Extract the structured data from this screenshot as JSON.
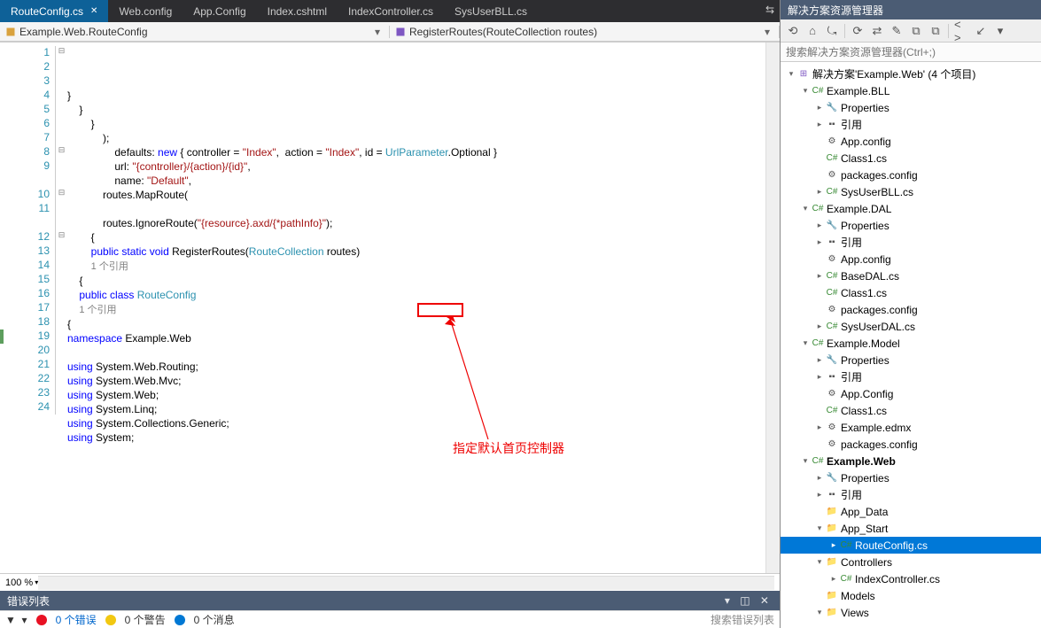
{
  "tabs": [
    {
      "label": "RouteConfig.cs",
      "active": true
    },
    {
      "label": "Web.config"
    },
    {
      "label": "App.Config"
    },
    {
      "label": "Index.cshtml"
    },
    {
      "label": "IndexController.cs"
    },
    {
      "label": "SysUserBLL.cs"
    }
  ],
  "breadcrumb": {
    "left": "Example.Web.RouteConfig",
    "right": "RegisterRoutes(RouteCollection routes)"
  },
  "code": {
    "lines": [
      {
        "n": "1",
        "h": "<span class='kw'>using</span> System;"
      },
      {
        "n": "2",
        "h": "<span class='kw'>using</span> System.Collections.Generic;"
      },
      {
        "n": "3",
        "h": "<span class='kw'>using</span> System.Linq;"
      },
      {
        "n": "4",
        "h": "<span class='kw'>using</span> System.Web;"
      },
      {
        "n": "5",
        "h": "<span class='kw'>using</span> System.Web.Mvc;"
      },
      {
        "n": "6",
        "h": "<span class='kw'>using</span> System.Web.Routing;"
      },
      {
        "n": "7",
        "h": ""
      },
      {
        "n": "8",
        "h": "<span class='kw'>namespace</span> Example.Web"
      },
      {
        "n": "9",
        "h": "{"
      },
      {
        "n": "",
        "h": "    <span class='cm'>1 个引用</span>"
      },
      {
        "n": "10",
        "h": "    <span class='kw'>public</span> <span class='kw'>class</span> <span class='tp'>RouteConfig</span>"
      },
      {
        "n": "11",
        "h": "    {"
      },
      {
        "n": "",
        "h": "        <span class='cm'>1 个引用</span>"
      },
      {
        "n": "12",
        "h": "        <span class='kw'>public</span> <span class='kw'>static</span> <span class='kw'>void</span> RegisterRoutes(<span class='tp'>RouteCollection</span> routes)"
      },
      {
        "n": "13",
        "h": "        {"
      },
      {
        "n": "14",
        "h": "            routes.IgnoreRoute(<span class='st'>\"{resource}.axd/{*pathInfo}\"</span>);"
      },
      {
        "n": "15",
        "h": ""
      },
      {
        "n": "16",
        "h": "            routes.MapRoute("
      },
      {
        "n": "17",
        "h": "                name: <span class='st'>\"Default\"</span>,"
      },
      {
        "n": "18",
        "h": "                url: <span class='st'>\"{controller}/{action}/{id}\"</span>,"
      },
      {
        "n": "19",
        "mod": true,
        "h": "                defaults: <span class='kw'>new</span> { controller = <span class='st'>\"Index\"</span>,  action = <span class='st'>\"Index\"</span>, id = <span class='tp'>UrlParameter</span>.Optional }"
      },
      {
        "n": "20",
        "h": "            );"
      },
      {
        "n": "21",
        "h": "        }"
      },
      {
        "n": "22",
        "h": "    }"
      },
      {
        "n": "23",
        "h": "}"
      },
      {
        "n": "24",
        "h": ""
      }
    ],
    "annotation": "指定默认首页控制器"
  },
  "zoom": "100 %",
  "error_list": {
    "title": "错误列表",
    "filter": "▼   ▾",
    "counts": {
      "errors": "0 个错误",
      "warnings": "0 个警告",
      "messages": "0 个消息"
    },
    "search_placeholder": "搜索错误列表"
  },
  "solution_explorer": {
    "title": "解决方案资源管理器",
    "search_placeholder": "搜索解决方案资源管理器(Ctrl+;)",
    "toolbar": [
      "⟲",
      "⌂",
      "⤿",
      "|",
      "⟳",
      "⇄",
      "✎",
      "⧉",
      "⧉",
      "|",
      "< >",
      "↙",
      "▾"
    ],
    "root": "解决方案'Example.Web' (4 个项目)",
    "tree": [
      {
        "d": 0,
        "exp": "▾",
        "ic": "sln",
        "t": "解决方案'Example.Web' (4 个项目)"
      },
      {
        "d": 1,
        "exp": "▾",
        "ic": "proj",
        "t": "Example.BLL"
      },
      {
        "d": 2,
        "exp": "▸",
        "ic": "wrench",
        "t": "Properties"
      },
      {
        "d": 2,
        "exp": "▸",
        "ic": "ref",
        "t": "引用"
      },
      {
        "d": 2,
        "exp": "",
        "ic": "cfg",
        "t": "App.config"
      },
      {
        "d": 2,
        "exp": "",
        "ic": "cs",
        "t": "Class1.cs"
      },
      {
        "d": 2,
        "exp": "",
        "ic": "cfg",
        "t": "packages.config"
      },
      {
        "d": 2,
        "exp": "▸",
        "ic": "cs",
        "t": "SysUserBLL.cs"
      },
      {
        "d": 1,
        "exp": "▾",
        "ic": "proj",
        "t": "Example.DAL"
      },
      {
        "d": 2,
        "exp": "▸",
        "ic": "wrench",
        "t": "Properties"
      },
      {
        "d": 2,
        "exp": "▸",
        "ic": "ref",
        "t": "引用"
      },
      {
        "d": 2,
        "exp": "",
        "ic": "cfg",
        "t": "App.config"
      },
      {
        "d": 2,
        "exp": "▸",
        "ic": "cs",
        "t": "BaseDAL.cs"
      },
      {
        "d": 2,
        "exp": "",
        "ic": "cs",
        "t": "Class1.cs"
      },
      {
        "d": 2,
        "exp": "",
        "ic": "cfg",
        "t": "packages.config"
      },
      {
        "d": 2,
        "exp": "▸",
        "ic": "cs",
        "t": "SysUserDAL.cs"
      },
      {
        "d": 1,
        "exp": "▾",
        "ic": "proj",
        "t": "Example.Model"
      },
      {
        "d": 2,
        "exp": "▸",
        "ic": "wrench",
        "t": "Properties"
      },
      {
        "d": 2,
        "exp": "▸",
        "ic": "ref",
        "t": "引用"
      },
      {
        "d": 2,
        "exp": "",
        "ic": "cfg",
        "t": "App.Config"
      },
      {
        "d": 2,
        "exp": "",
        "ic": "cs",
        "t": "Class1.cs"
      },
      {
        "d": 2,
        "exp": "▸",
        "ic": "cfg",
        "t": "Example.edmx"
      },
      {
        "d": 2,
        "exp": "",
        "ic": "cfg",
        "t": "packages.config"
      },
      {
        "d": 1,
        "exp": "▾",
        "ic": "proj",
        "t": "Example.Web",
        "bold": true
      },
      {
        "d": 2,
        "exp": "▸",
        "ic": "wrench",
        "t": "Properties"
      },
      {
        "d": 2,
        "exp": "▸",
        "ic": "ref",
        "t": "引用"
      },
      {
        "d": 2,
        "exp": "",
        "ic": "folder",
        "t": "App_Data"
      },
      {
        "d": 2,
        "exp": "▾",
        "ic": "folder",
        "t": "App_Start"
      },
      {
        "d": 3,
        "exp": "▸",
        "ic": "cs",
        "t": "RouteConfig.cs",
        "sel": true
      },
      {
        "d": 2,
        "exp": "▾",
        "ic": "folder",
        "t": "Controllers"
      },
      {
        "d": 3,
        "exp": "▸",
        "ic": "cs",
        "t": "IndexController.cs"
      },
      {
        "d": 2,
        "exp": "",
        "ic": "folder",
        "t": "Models"
      },
      {
        "d": 2,
        "exp": "▾",
        "ic": "folder",
        "t": "Views"
      }
    ]
  }
}
